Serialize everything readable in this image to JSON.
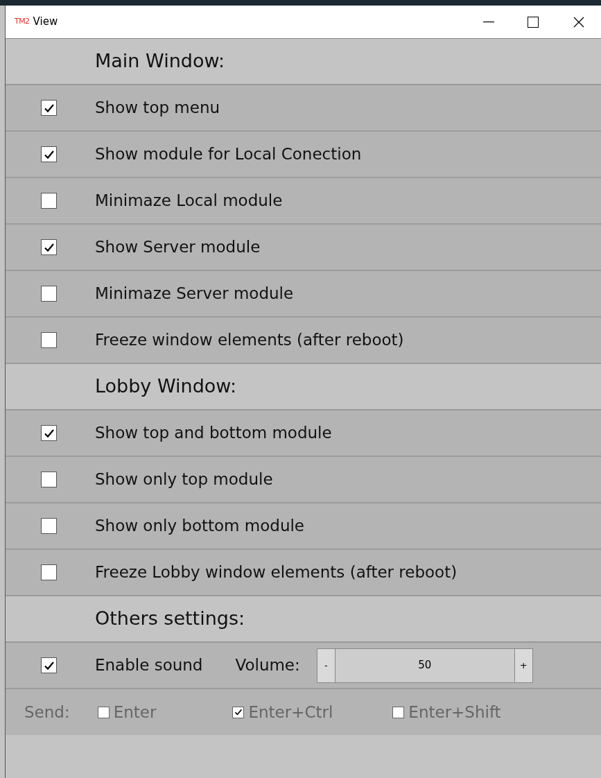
{
  "window": {
    "title": "View",
    "logo": "TM2"
  },
  "sections": [
    {
      "heading": "Main Window:",
      "items": [
        {
          "label": "Show top menu",
          "checked": true
        },
        {
          "label": "Show module for Local Conection",
          "checked": true
        },
        {
          "label": "Minimaze Local module",
          "checked": false
        },
        {
          "label": "Show Server module",
          "checked": true
        },
        {
          "label": "Minimaze Server module",
          "checked": false
        },
        {
          "label": "Freeze window elements (after reboot)",
          "checked": false
        }
      ]
    },
    {
      "heading": "Lobby Window:",
      "items": [
        {
          "label": "Show top and bottom module",
          "checked": true
        },
        {
          "label": "Show only top module",
          "checked": false
        },
        {
          "label": "Show only bottom module",
          "checked": false
        },
        {
          "label": "Freeze Lobby window elements (after reboot)",
          "checked": false
        }
      ]
    },
    {
      "heading": "Others settings:"
    }
  ],
  "sound": {
    "label": "Enable sound",
    "checked": true,
    "volume_label": "Volume:",
    "decrement": "-",
    "value": "50",
    "increment": "+"
  },
  "send": {
    "label": "Send:",
    "options": [
      {
        "label": "Enter",
        "checked": false
      },
      {
        "label": "Enter+Ctrl",
        "checked": true
      },
      {
        "label": "Enter+Shift",
        "checked": false
      }
    ]
  }
}
